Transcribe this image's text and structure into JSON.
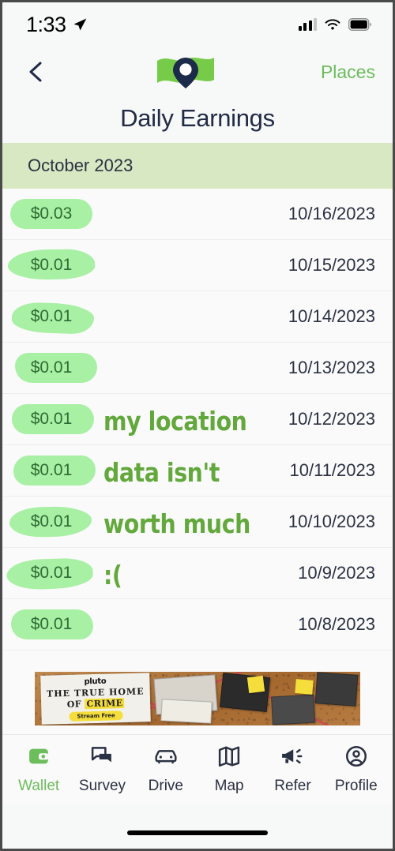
{
  "status_bar": {
    "time": "1:33",
    "location_icon": "location-arrow-icon",
    "signal_icon": "cellular-signal-icon",
    "wifi_icon": "wifi-icon",
    "battery_icon": "battery-full-icon"
  },
  "nav": {
    "back_icon": "chevron-left-icon",
    "logo_icon": "map-pin-flag-logo",
    "places_label": "Places"
  },
  "header": {
    "title": "Daily Earnings"
  },
  "month_section": {
    "label": "October 2023"
  },
  "earnings": {
    "rows": [
      {
        "amount": "$0.03",
        "date": "10/16/2023"
      },
      {
        "amount": "$0.01",
        "date": "10/15/2023"
      },
      {
        "amount": "$0.01",
        "date": "10/14/2023"
      },
      {
        "amount": "$0.01",
        "date": "10/13/2023"
      },
      {
        "amount": "$0.01",
        "date": "10/12/2023"
      },
      {
        "amount": "$0.01",
        "date": "10/11/2023"
      },
      {
        "amount": "$0.01",
        "date": "10/10/2023"
      },
      {
        "amount": "$0.01",
        "date": "10/9/2023"
      },
      {
        "amount": "$0.01",
        "date": "10/8/2023"
      }
    ]
  },
  "overlay_annotation": {
    "lines": [
      "my location",
      "data isn't",
      "worth much",
      ":("
    ],
    "color": "#62a83c"
  },
  "ad": {
    "brand": "pluto",
    "headline_line1": "THE TRUE HOME",
    "headline_line2_prefix": "OF ",
    "headline_line2_highlight": "CRIME",
    "cta": "Stream Free"
  },
  "tab_bar": {
    "items": [
      {
        "label": "Wallet",
        "icon": "wallet-icon",
        "active": true
      },
      {
        "label": "Survey",
        "icon": "chat-bubbles-icon",
        "active": false
      },
      {
        "label": "Drive",
        "icon": "car-icon",
        "active": false
      },
      {
        "label": "Map",
        "icon": "map-icon",
        "active": false
      },
      {
        "label": "Refer",
        "icon": "megaphone-icon",
        "active": false
      },
      {
        "label": "Profile",
        "icon": "user-circle-icon",
        "active": false
      }
    ]
  },
  "colors": {
    "accent_green": "#6cbd5c",
    "highlight_green": "#a8f0a4",
    "month_band": "#d8e8c2",
    "text_navy": "#2a3142",
    "meme_green": "#62a83c"
  }
}
